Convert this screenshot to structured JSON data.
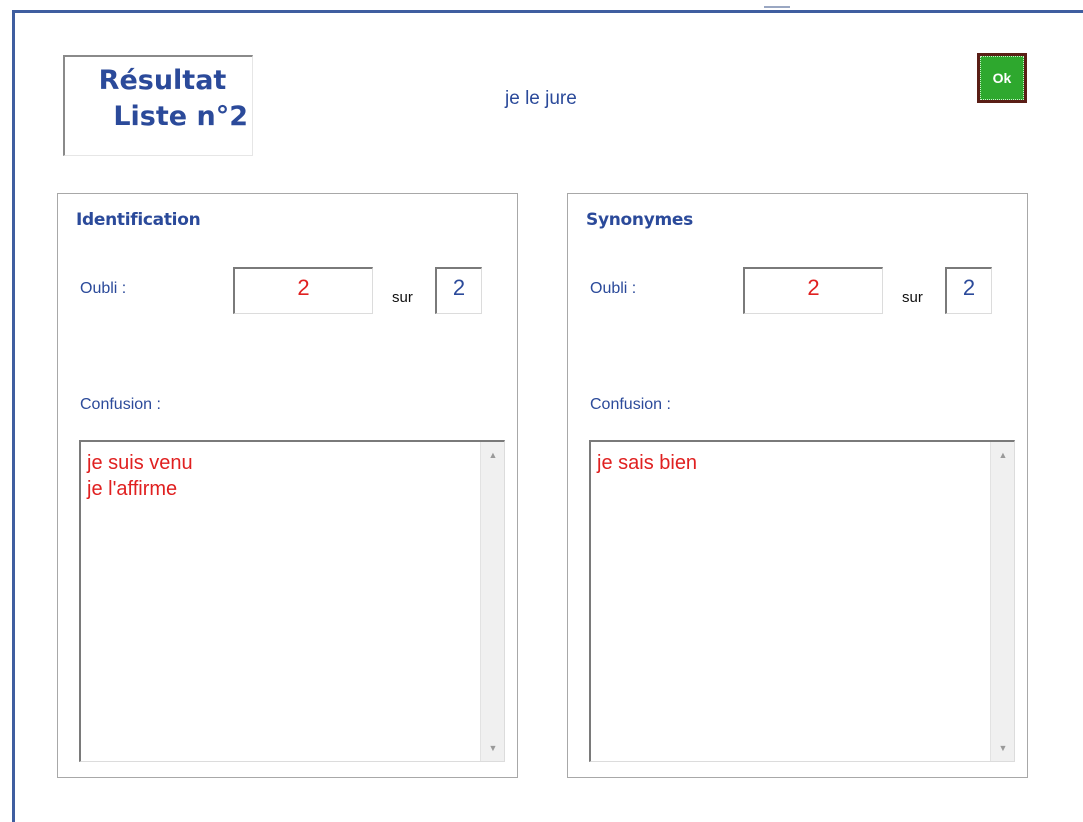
{
  "header": {
    "title_line1": "Résultat",
    "title_line2": "Liste n°2",
    "word": "je le jure",
    "ok_label": "Ok"
  },
  "groups": [
    {
      "title": "Identification",
      "oubli_label": "Oubli :",
      "oubli_value": "2",
      "sur_label": "sur",
      "total_value": "2",
      "confusion_label": "Confusion :",
      "confusion_items": [
        "je suis venu",
        "je l'affirme"
      ]
    },
    {
      "title": "Synonymes",
      "oubli_label": "Oubli :",
      "oubli_value": "2",
      "sur_label": "sur",
      "total_value": "2",
      "confusion_label": "Confusion :",
      "confusion_items": [
        "je sais bien"
      ]
    }
  ],
  "colors": {
    "accent": "#2b4a9a",
    "error": "#e02020",
    "ok_button": "#2ea82e",
    "ok_border": "#5a1e16"
  },
  "icons": {
    "scroll_up": "scroll-up-arrow-icon",
    "scroll_down": "scroll-down-arrow-icon"
  }
}
